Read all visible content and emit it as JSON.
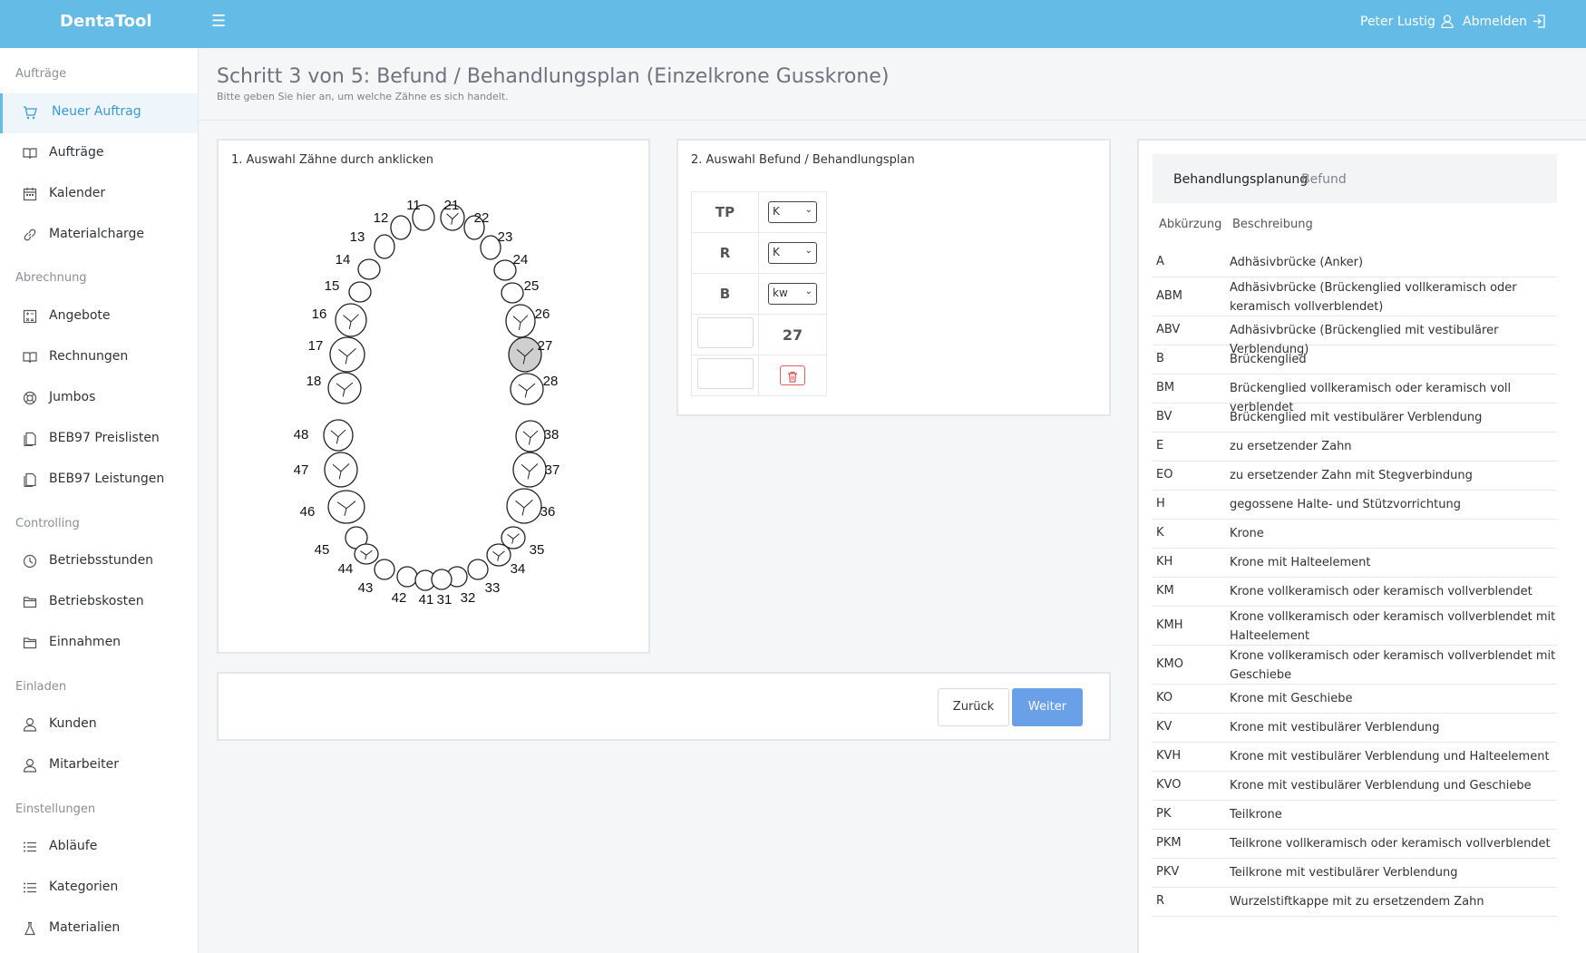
{
  "app": {
    "brand": "DentaTool",
    "user_name": "Peter Lustig",
    "logout_label": "Abmelden"
  },
  "sidebar": {
    "sections": [
      "Aufträge",
      "Abrechnung",
      "Controlling",
      "Einladen",
      "Einstellungen"
    ],
    "items": [
      {
        "label": "Neuer Auftrag",
        "icon": "cart-icon",
        "active": true
      },
      {
        "label": "Aufträge",
        "icon": "book-icon"
      },
      {
        "label": "Kalender",
        "icon": "calendar-icon"
      },
      {
        "label": "Materialcharge",
        "icon": "link-icon"
      },
      {
        "label": "Angebote",
        "icon": "calculator-icon"
      },
      {
        "label": "Rechnungen",
        "icon": "book-icon"
      },
      {
        "label": "Jumbos",
        "icon": "lifebuoy-icon"
      },
      {
        "label": "BEB97 Preislisten",
        "icon": "files-icon"
      },
      {
        "label": "BEB97 Leistungen",
        "icon": "files-icon"
      },
      {
        "label": "Betriebsstunden",
        "icon": "clock-icon"
      },
      {
        "label": "Betriebskosten",
        "icon": "folder-icon"
      },
      {
        "label": "Einnahmen",
        "icon": "folder-icon"
      },
      {
        "label": "Kunden",
        "icon": "user-icon"
      },
      {
        "label": "Mitarbeiter",
        "icon": "user-icon"
      },
      {
        "label": "Abläufe",
        "icon": "list-icon"
      },
      {
        "label": "Kategorien",
        "icon": "list-icon"
      },
      {
        "label": "Materialien",
        "icon": "flask-icon"
      }
    ]
  },
  "page": {
    "title": "Schritt 3 von 5: Befund / Behandlungsplan (Einzelkrone Gusskrone)",
    "subtitle": "Bitte geben Sie hier an, um welche Zähne es sich handelt."
  },
  "tooth_chart": {
    "heading": "1. Auswahl Zähne durch anklicken",
    "selected_tooth": "27",
    "labels": [
      "11",
      "12",
      "13",
      "14",
      "15",
      "16",
      "17",
      "18",
      "21",
      "22",
      "23",
      "24",
      "25",
      "26",
      "27",
      "28",
      "31",
      "32",
      "33",
      "34",
      "35",
      "36",
      "37",
      "38",
      "41",
      "42",
      "43",
      "44",
      "45",
      "46",
      "47",
      "48"
    ]
  },
  "befund": {
    "heading": "2. Auswahl Befund / Behandlungsplan",
    "rows": [
      {
        "key": "TP",
        "value": "K"
      },
      {
        "key": "R",
        "value": "K"
      },
      {
        "key": "B",
        "value": "kw"
      }
    ],
    "tooth_number": "27",
    "delete_icon": "trash-icon",
    "danger_color": "#e05555"
  },
  "actions": {
    "back_label": "Zurück",
    "next_label": "Weiter",
    "primary_color": "#6aa0e8"
  },
  "codes": {
    "tabs": [
      "Behandlungsplanung",
      "Befund"
    ],
    "active_tab": "Behandlungsplanung",
    "columns": [
      "Abkürzung",
      "Beschreibung"
    ],
    "rows": [
      {
        "abbr": "A",
        "desc": "Adhäsivbrücke (Anker)"
      },
      {
        "abbr": "ABM",
        "desc": "Adhäsivbrücke (Brückenglied vollkeramisch oder keramisch vollverblendet)"
      },
      {
        "abbr": "ABV",
        "desc": "Adhäsivbrücke (Brückenglied mit vestibulärer Verblendung)"
      },
      {
        "abbr": "B",
        "desc": "Brückenglied"
      },
      {
        "abbr": "BM",
        "desc": "Brückenglied vollkeramisch oder keramisch voll verblendet"
      },
      {
        "abbr": "BV",
        "desc": "Brückenglied mit vestibulärer Verblendung"
      },
      {
        "abbr": "E",
        "desc": "zu ersetzender Zahn"
      },
      {
        "abbr": "EO",
        "desc": "zu ersetzender Zahn mit Stegverbindung"
      },
      {
        "abbr": "H",
        "desc": "gegossene Halte- und Stützvorrichtung"
      },
      {
        "abbr": "K",
        "desc": "Krone"
      },
      {
        "abbr": "KH",
        "desc": "Krone mit Halteelement"
      },
      {
        "abbr": "KM",
        "desc": "Krone vollkeramisch oder keramisch vollverblendet"
      },
      {
        "abbr": "KMH",
        "desc": "Krone vollkeramisch oder keramisch vollverblendet mit Halteelement"
      },
      {
        "abbr": "KMO",
        "desc": "Krone vollkeramisch oder keramisch vollverblendet mit Geschiebe"
      },
      {
        "abbr": "KO",
        "desc": "Krone mit Geschiebe"
      },
      {
        "abbr": "KV",
        "desc": "Krone mit vestibulärer Verblendung"
      },
      {
        "abbr": "KVH",
        "desc": "Krone mit vestibulärer Verblendung und Halteelement"
      },
      {
        "abbr": "KVO",
        "desc": "Krone mit vestibulärer Verblendung und Geschiebe"
      },
      {
        "abbr": "PK",
        "desc": "Teilkrone"
      },
      {
        "abbr": "PKM",
        "desc": "Teilkrone vollkeramisch oder keramisch vollverblendet"
      },
      {
        "abbr": "PKV",
        "desc": "Teilkrone mit vestibulärer Verblendung"
      },
      {
        "abbr": "R",
        "desc": "Wurzelstiftkappe mit zu ersetzendem Zahn"
      }
    ]
  }
}
